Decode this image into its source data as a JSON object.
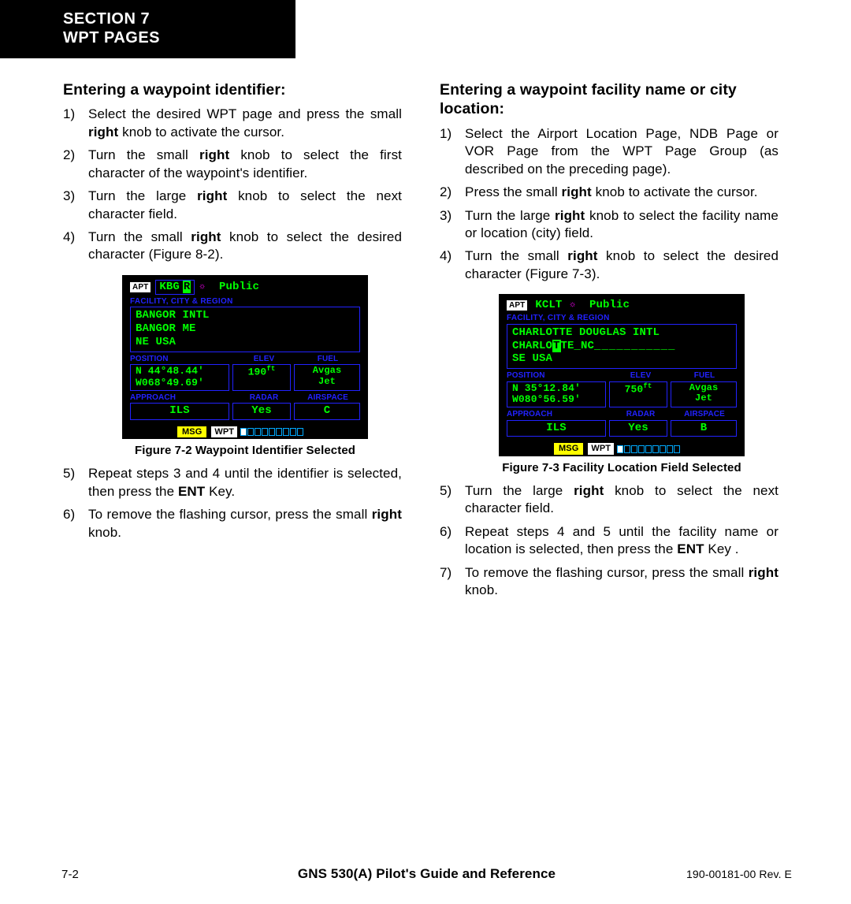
{
  "header": {
    "line1": "SECTION 7",
    "line2": "WPT PAGES"
  },
  "left": {
    "heading": "Entering a waypoint identifier:",
    "steps": [
      {
        "n": "1)",
        "pre": "Select the desired WPT page and press the small ",
        "bold": "right",
        "post": " knob to activate the cursor."
      },
      {
        "n": "2)",
        "pre": "Turn the small ",
        "bold": "right",
        "post": " knob to select the first character of the waypoint's identifier."
      },
      {
        "n": "3)",
        "pre": "Turn the large ",
        "bold": "right",
        "post": " knob to select the next character field."
      },
      {
        "n": "4)",
        "pre": "Turn the small ",
        "bold": "right",
        "post": " knob to select the desired character (Figure 8-2)."
      },
      {
        "n": "5)",
        "pre": "Repeat steps 3 and 4 until the identifier is selected, then press the ",
        "bold": "ENT",
        "post": " Key."
      },
      {
        "n": "6)",
        "pre": "To remove the flashing cursor, press the small ",
        "bold": "right",
        "post": " knob."
      }
    ],
    "figure": {
      "caption": "Figure 7-2  Waypoint Identifier Selected",
      "apt": "APT",
      "ident_pre": "KBG",
      "ident_cur": "R",
      "symbol": "☼",
      "public": "Public",
      "section": "FACILITY, CITY & REGION",
      "facility": [
        "BANGOR INTL",
        "BANGOR ME",
        "NE USA"
      ],
      "labels1": [
        "POSITION",
        "ELEV",
        "FUEL"
      ],
      "pos": [
        "N  44°48.44'",
        "W068°49.69'"
      ],
      "elev": "190",
      "elev_u": "ft",
      "fuel": [
        "Avgas",
        "Jet"
      ],
      "labels2": [
        "APPROACH",
        "RADAR",
        "AIRSPACE"
      ],
      "app": "ILS",
      "radar": "Yes",
      "airspace": "C",
      "msg": "MSG",
      "wpt": "WPT"
    }
  },
  "right": {
    "heading": "Entering a waypoint facility name or city location:",
    "steps": [
      {
        "n": "1)",
        "pre": "Select the Airport Location Page, NDB Page or VOR Page from the WPT Page Group (as described on the preceding page).",
        "bold": "",
        "post": ""
      },
      {
        "n": "2)",
        "pre": "Press the small ",
        "bold": "right",
        "post": " knob to activate the cursor."
      },
      {
        "n": "3)",
        "pre": "Turn the large ",
        "bold": "right",
        "post": " knob to select the facility name or location (city) field."
      },
      {
        "n": "4)",
        "pre": "Turn the small ",
        "bold": "right",
        "post": " knob to select the desired character (Figure 7-3)."
      },
      {
        "n": "5)",
        "pre": "Turn the large ",
        "bold": "right",
        "post": " knob to select the next character field."
      },
      {
        "n": "6)",
        "pre": "Repeat steps 4 and 5 until the facility name or location is selected, then press the ",
        "bold": "ENT",
        "post": " Key ."
      },
      {
        "n": "7)",
        "pre": "To remove the flashing cursor, press the small ",
        "bold": "right",
        "post": " knob."
      }
    ],
    "figure": {
      "caption": "Figure 7-3  Facility Location Field Selected",
      "apt": "APT",
      "ident": "KCLT",
      "symbol": "☼",
      "public": "Public",
      "section": "FACILITY, CITY & REGION",
      "facility_l1": "CHARLOTTE DOUGLAS INTL",
      "facility_l2_pre": "CHARLO",
      "facility_l2_cur": "T",
      "facility_l2_post": "TE_NC",
      "facility_l2_tail": "___________",
      "facility_l3": "SE USA",
      "labels1": [
        "POSITION",
        "ELEV",
        "FUEL"
      ],
      "pos": [
        "N  35°12.84'",
        "W080°56.59'"
      ],
      "elev": "750",
      "elev_u": "ft",
      "fuel": [
        "Avgas",
        "Jet"
      ],
      "labels2": [
        "APPROACH",
        "RADAR",
        "AIRSPACE"
      ],
      "app": "ILS",
      "radar": "Yes",
      "airspace": "B",
      "msg": "MSG",
      "wpt": "WPT"
    }
  },
  "footer": {
    "page": "7-2",
    "title": "GNS 530(A) Pilot's Guide and Reference",
    "rev": "190-00181-00  Rev. E"
  }
}
